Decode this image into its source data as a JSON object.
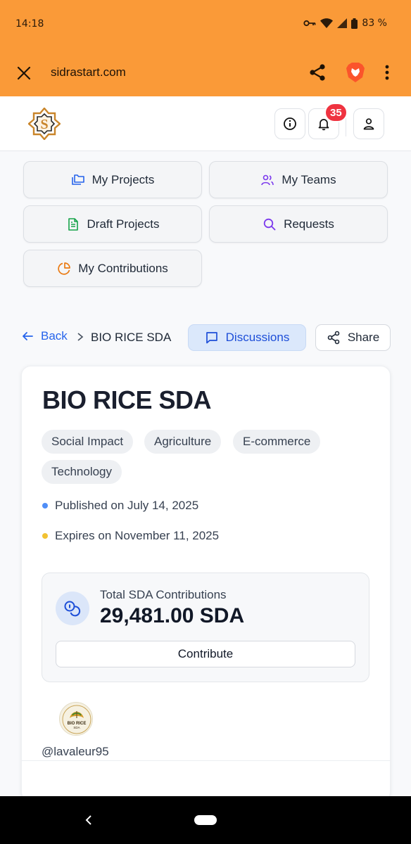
{
  "status_bar": {
    "time": "14:18",
    "battery": "83 %"
  },
  "browser": {
    "url": "sidrastart.com"
  },
  "header": {
    "notification_count": "35"
  },
  "nav": {
    "my_projects": "My Projects",
    "my_teams": "My Teams",
    "draft_projects": "Draft Projects",
    "requests": "Requests",
    "my_contributions": "My Contributions"
  },
  "breadcrumb": {
    "back": "Back",
    "current": "BIO RICE SDA"
  },
  "actions": {
    "discussions": "Discussions",
    "share": "Share"
  },
  "project": {
    "title": "BIO RICE SDA",
    "tags": [
      "Social Impact",
      "Agriculture",
      "E-commerce",
      "Technology"
    ],
    "published": "Published on July 14, 2025",
    "expires": "Expires on November 11, 2025",
    "contributions_label": "Total SDA Contributions",
    "contributions_value": "29,481.00 SDA",
    "contribute_button": "Contribute",
    "owner": "@lavaleur95",
    "avatar_logo": {
      "line1": "BIO RICE",
      "line2": "SDA"
    }
  },
  "colors": {
    "browser_bar": "#fa9a38",
    "accent_blue": "#2563eb",
    "badge_red": "#ef3340",
    "published_dot": "#4f8ef7",
    "expires_dot": "#f2c232"
  }
}
